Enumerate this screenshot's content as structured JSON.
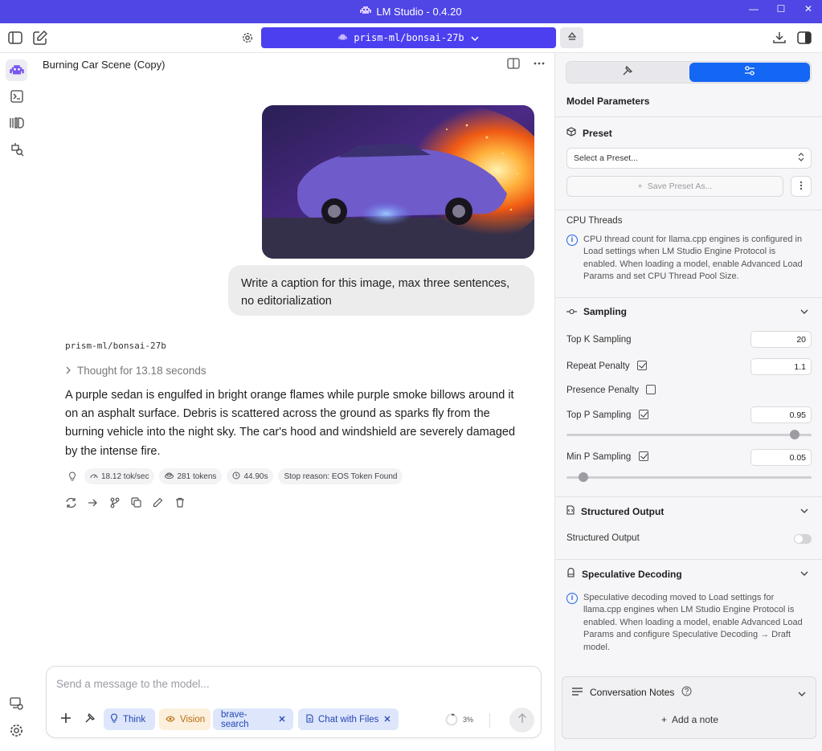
{
  "window": {
    "title": "LM Studio - 0.4.20",
    "minimize": "—",
    "maximize": "☐",
    "close": "✕"
  },
  "toolbar": {
    "model_name": "prism-ml/bonsai-27b"
  },
  "chat": {
    "title": "Burning Car Scene (Copy)",
    "user_message": "Write a caption for this image, max three sentences, no editorialization",
    "ai_model": "prism-ml/bonsai-27b",
    "thought": "Thought for 13.18 seconds",
    "ai_response": "A purple sedan is engulfed in bright orange flames while purple smoke billows around it on an asphalt surface. Debris is scattered across the ground as sparks fly from the burning vehicle into the night sky. The car's hood and windshield are severely damaged by the intense fire.",
    "stats": {
      "speed": "18.12 tok/sec",
      "tokens": "281 tokens",
      "time": "44.90s",
      "stop_reason": "Stop reason: EOS Token Found"
    }
  },
  "composer": {
    "placeholder": "Send a message to the model...",
    "think_label": "Think",
    "vision_label": "Vision",
    "plugin1": "brave-search",
    "plugin2": "Chat with Files",
    "context_usage": "3%",
    "context_fraction": 0.03
  },
  "panel": {
    "title": "Model Parameters",
    "preset": {
      "title": "Preset",
      "select_placeholder": "Select a Preset...",
      "save_label": "Save Preset As..."
    },
    "cpu": {
      "title": "CPU Threads",
      "info": "CPU thread count for llama.cpp engines is configured in Load settings when LM Studio Engine Protocol is enabled. When loading a model, enable Advanced Load Params and set CPU Thread Pool Size."
    },
    "sampling": {
      "title": "Sampling",
      "top_k_label": "Top K Sampling",
      "top_k": "20",
      "repeat_label": "Repeat Penalty",
      "repeat": "1.1",
      "presence_label": "Presence Penalty",
      "top_p_label": "Top P Sampling",
      "top_p": "0.95",
      "top_p_fraction": 0.93,
      "min_p_label": "Min P Sampling",
      "min_p": "0.05",
      "min_p_fraction": 0.07
    },
    "structured": {
      "title": "Structured Output",
      "label": "Structured Output"
    },
    "speculative": {
      "title": "Speculative Decoding",
      "info": "Speculative decoding moved to Load settings for llama.cpp engines when LM Studio Engine Protocol is enabled. When loading a model, enable Advanced Load Params and configure Speculative Decoding → Draft model."
    },
    "notes": {
      "title": "Conversation Notes",
      "add_label": "Add a note"
    }
  },
  "colors": {
    "accent": "#4c3ff0",
    "blue": "#1466f4",
    "title_bar": "#4f46e5"
  }
}
